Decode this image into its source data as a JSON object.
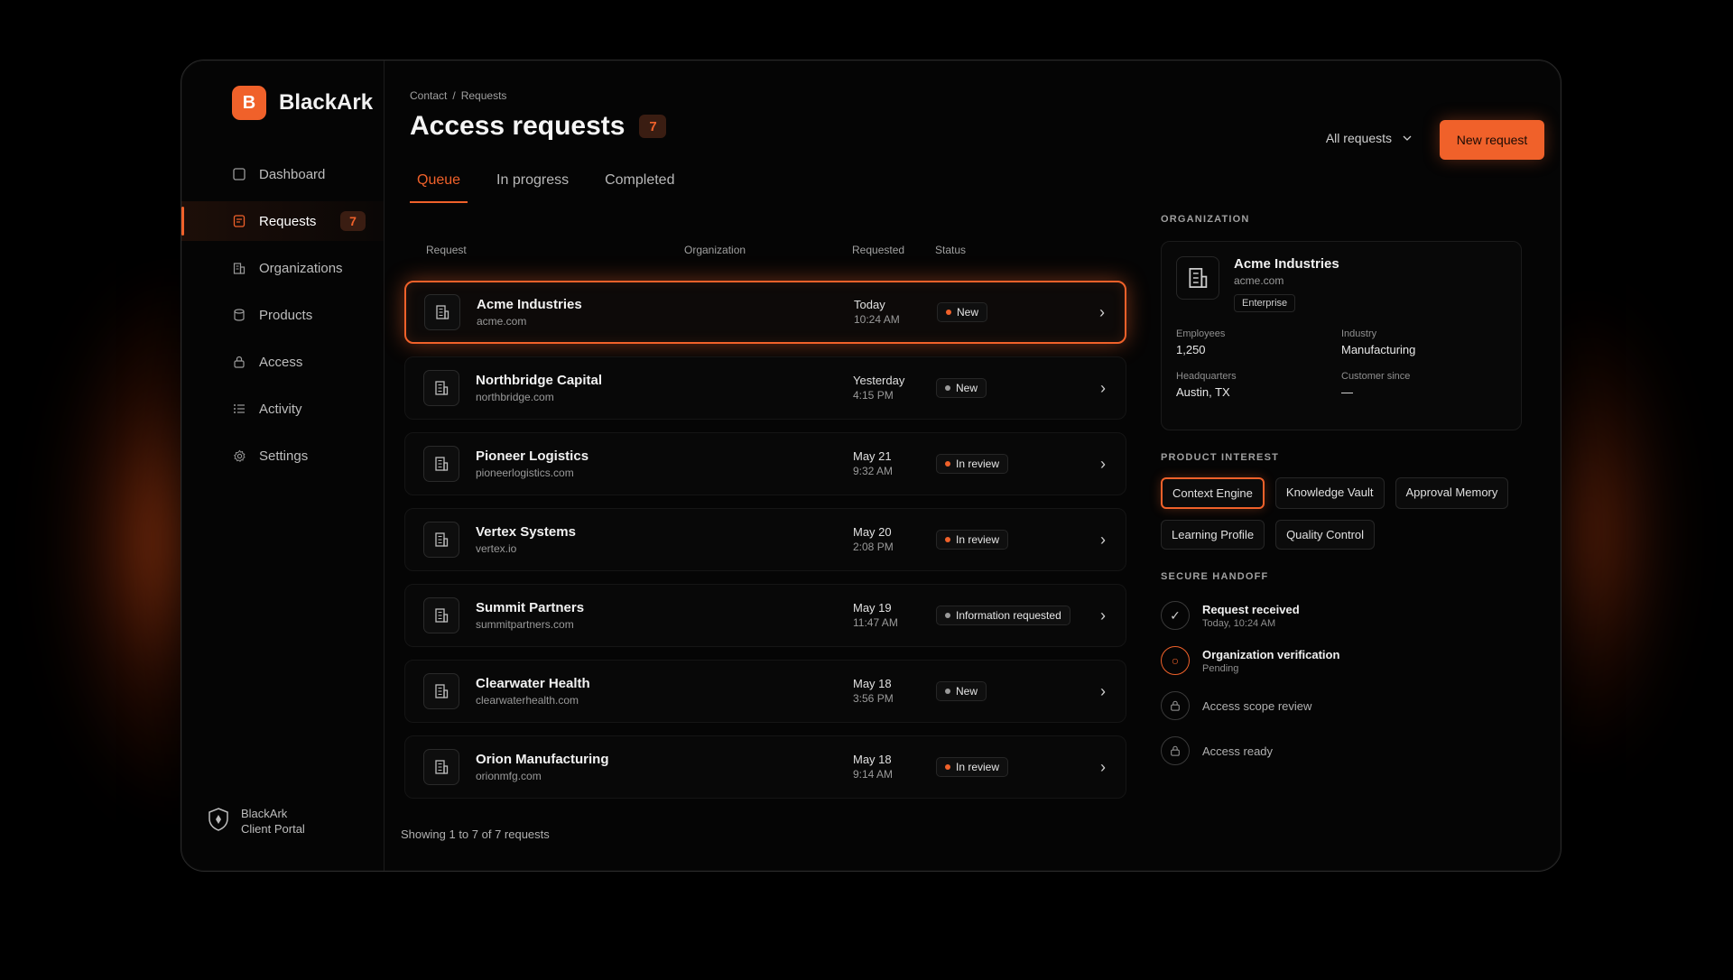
{
  "brand": {
    "name": "BlackArk",
    "logo_letter": "B"
  },
  "sidebar": {
    "items": [
      {
        "label": "Dashboard",
        "icon": "square-icon"
      },
      {
        "label": "Requests",
        "icon": "document-icon",
        "badge": "7",
        "active": true
      },
      {
        "label": "Organizations",
        "icon": "building-icon"
      },
      {
        "label": "Products",
        "icon": "cylinder-icon"
      },
      {
        "label": "Access",
        "icon": "lock-icon"
      },
      {
        "label": "Activity",
        "icon": "list-icon"
      },
      {
        "label": "Settings",
        "icon": "gear-icon"
      }
    ],
    "footer_line1": "BlackArk",
    "footer_line2": "Client Portal"
  },
  "header": {
    "breadcrumb": [
      "Contact",
      "Requests"
    ],
    "breadcrumb_sep": "/",
    "title": "Access requests",
    "title_badge": "7",
    "filter_label": "All requests",
    "new_button": "New request"
  },
  "tabs": [
    {
      "label": "Queue",
      "active": true
    },
    {
      "label": "In progress"
    },
    {
      "label": "Completed"
    }
  ],
  "table": {
    "columns": {
      "request": "Request",
      "organization": "Organization",
      "requested": "Requested",
      "status": "Status"
    },
    "rows": [
      {
        "name": "Acme Industries",
        "domain": "acme.com",
        "date": "Today",
        "time": "10:24 AM",
        "status": "New",
        "status_color": "#f0612a"
      },
      {
        "name": "Northbridge Capital",
        "domain": "northbridge.com",
        "date": "Yesterday",
        "time": "4:15 PM",
        "status": "New",
        "status_color": "#9a9a9a"
      },
      {
        "name": "Pioneer Logistics",
        "domain": "pioneerlogistics.com",
        "date": "May 21",
        "time": "9:32 AM",
        "status": "In review",
        "status_color": "#f0612a"
      },
      {
        "name": "Vertex Systems",
        "domain": "vertex.io",
        "date": "May 20",
        "time": "2:08 PM",
        "status": "In review",
        "status_color": "#f0612a"
      },
      {
        "name": "Summit Partners",
        "domain": "summitpartners.com",
        "date": "May 19",
        "time": "11:47 AM",
        "status": "Information requested",
        "status_color": "#9a9a9a"
      },
      {
        "name": "Clearwater Health",
        "domain": "clearwaterhealth.com",
        "date": "May 18",
        "time": "3:56 PM",
        "status": "New",
        "status_color": "#9a9a9a"
      },
      {
        "name": "Orion Manufacturing",
        "domain": "orionmfg.com",
        "date": "May 18",
        "time": "9:14 AM",
        "status": "In review",
        "status_color": "#f0612a"
      }
    ],
    "showing": "Showing 1 to 7 of 7 requests"
  },
  "organization": {
    "section_label": "ORGANIZATION",
    "name": "Acme Industries",
    "domain": "acme.com",
    "tier": "Enterprise",
    "facts": [
      {
        "label": "Employees",
        "value": "1,250"
      },
      {
        "label": "Industry",
        "value": "Manufacturing"
      },
      {
        "label": "Headquarters",
        "value": "Austin, TX"
      },
      {
        "label": "Customer since",
        "value": "—"
      }
    ]
  },
  "product_interest": {
    "section_label": "PRODUCT INTEREST",
    "items": [
      "Context Engine",
      "Knowledge Vault",
      "Approval Memory",
      "Learning Profile",
      "Quality Control"
    ]
  },
  "handoff": {
    "section_label": "SECURE HANDOFF",
    "steps": [
      {
        "title": "Request received",
        "sub": "Today, 10:24 AM",
        "state": "done"
      },
      {
        "title": "Organization verification",
        "sub": "Pending",
        "state": "pending"
      },
      {
        "title": "Access scope review",
        "sub": "",
        "state": "locked"
      },
      {
        "title": "Access ready",
        "sub": "",
        "state": "locked"
      }
    ]
  },
  "colors": {
    "accent": "#f0612a",
    "background": "#050505"
  }
}
